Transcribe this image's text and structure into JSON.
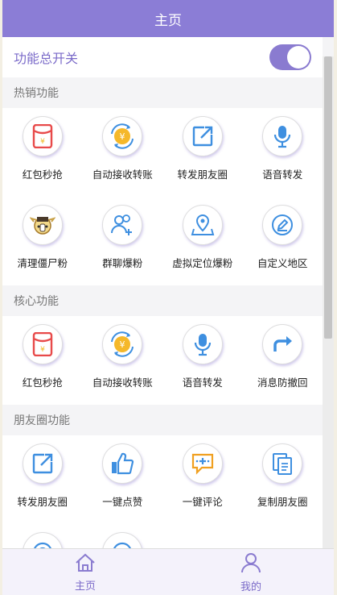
{
  "header": {
    "title": "主页"
  },
  "master_switch": {
    "label": "功能总开关",
    "on": true
  },
  "sections": [
    {
      "title": "热销功能",
      "items": [
        {
          "label": "红包秒抢",
          "icon": "red-envelope-icon"
        },
        {
          "label": "自动接收转账",
          "icon": "transfer-yen-icon"
        },
        {
          "label": "转发朋友圈",
          "icon": "share-arrow-icon"
        },
        {
          "label": "语音转发",
          "icon": "microphone-icon"
        },
        {
          "label": "清理僵尸粉",
          "icon": "zombie-icon"
        },
        {
          "label": "群聊爆粉",
          "icon": "add-users-icon"
        },
        {
          "label": "虚拟定位爆粉",
          "icon": "location-pin-icon"
        },
        {
          "label": "自定义地区",
          "icon": "edit-pencil-icon"
        }
      ]
    },
    {
      "title": "核心功能",
      "items": [
        {
          "label": "红包秒抢",
          "icon": "red-envelope-icon"
        },
        {
          "label": "自动接收转账",
          "icon": "transfer-yen-icon"
        },
        {
          "label": "语音转发",
          "icon": "microphone-icon"
        },
        {
          "label": "消息防撤回",
          "icon": "redo-arrow-icon"
        }
      ]
    },
    {
      "title": "朋友圈功能",
      "items": [
        {
          "label": "转发朋友圈",
          "icon": "share-arrow-icon"
        },
        {
          "label": "一键点赞",
          "icon": "thumbs-up-icon"
        },
        {
          "label": "一键评论",
          "icon": "comment-plus-icon"
        },
        {
          "label": "复制朋友圈",
          "icon": "copy-document-icon"
        },
        {
          "label": "",
          "icon": "partial-icon"
        },
        {
          "label": "",
          "icon": "partial-icon"
        }
      ]
    }
  ],
  "tabbar": {
    "tabs": [
      {
        "label": "主页",
        "icon": "home-icon"
      },
      {
        "label": "我的",
        "icon": "profile-icon"
      }
    ]
  },
  "colors": {
    "accent": "#8b7dd6",
    "icon_blue": "#3e8fe0",
    "envelope_red": "#e84a4a",
    "yen_gold": "#f0b81e"
  }
}
